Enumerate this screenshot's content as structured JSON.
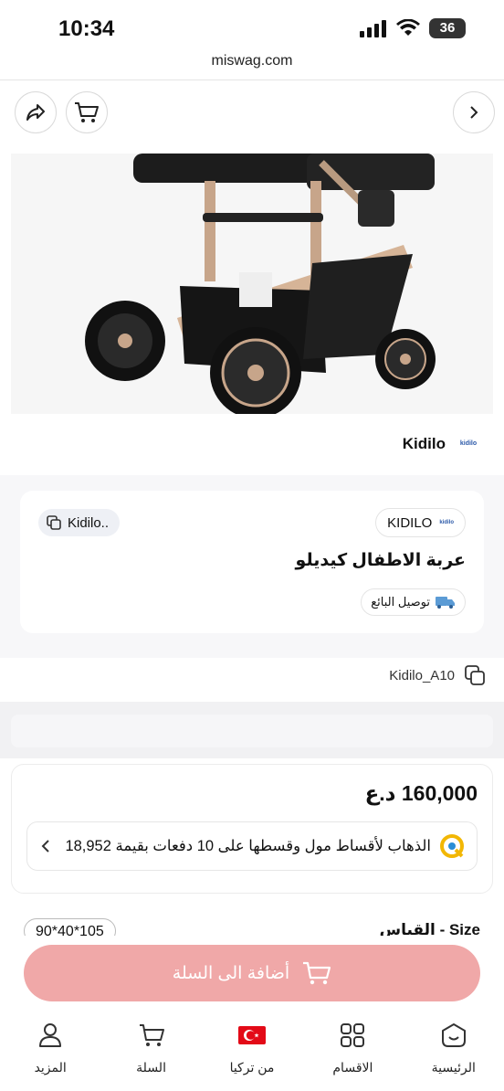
{
  "status_bar": {
    "time": "10:34",
    "battery": "36"
  },
  "browser": {
    "url": "miswag.com"
  },
  "top_actions": {
    "share_icon": "share-icon",
    "cart_icon": "cart-icon",
    "forward_icon": "chevron-right-icon"
  },
  "brand": {
    "name": "Kidilo",
    "logo_text": "kidilo"
  },
  "product": {
    "copy_chip": "Kidilo..",
    "brand_chip": "KIDILO",
    "brand_chip_logo": "kidilo",
    "title": "عربة الاطفال كيديلو",
    "delivery": "توصيل البائع",
    "sku": "Kidilo_A10"
  },
  "price": {
    "amount": "160,000 د.ع",
    "installment": "الذهاب لأقساط مول وقسطها على 10 دفعات بقيمة 18,952"
  },
  "size": {
    "label": "Size - القياس",
    "value": "90*40*105"
  },
  "add_to_cart": {
    "label": "أضافة الى السلة",
    "color": "#f0a8a8"
  },
  "bottom_nav": [
    {
      "label": "الرئيسية",
      "icon": "home-face-icon"
    },
    {
      "label": "الاقسام",
      "icon": "grid-icon"
    },
    {
      "label": "من تركيا",
      "icon": "turkey-flag-icon"
    },
    {
      "label": "السلة",
      "icon": "cart-icon"
    },
    {
      "label": "المزيد",
      "icon": "user-icon"
    }
  ],
  "colors": {
    "accent": "#f0a8a8",
    "flag": "#e30a17"
  }
}
